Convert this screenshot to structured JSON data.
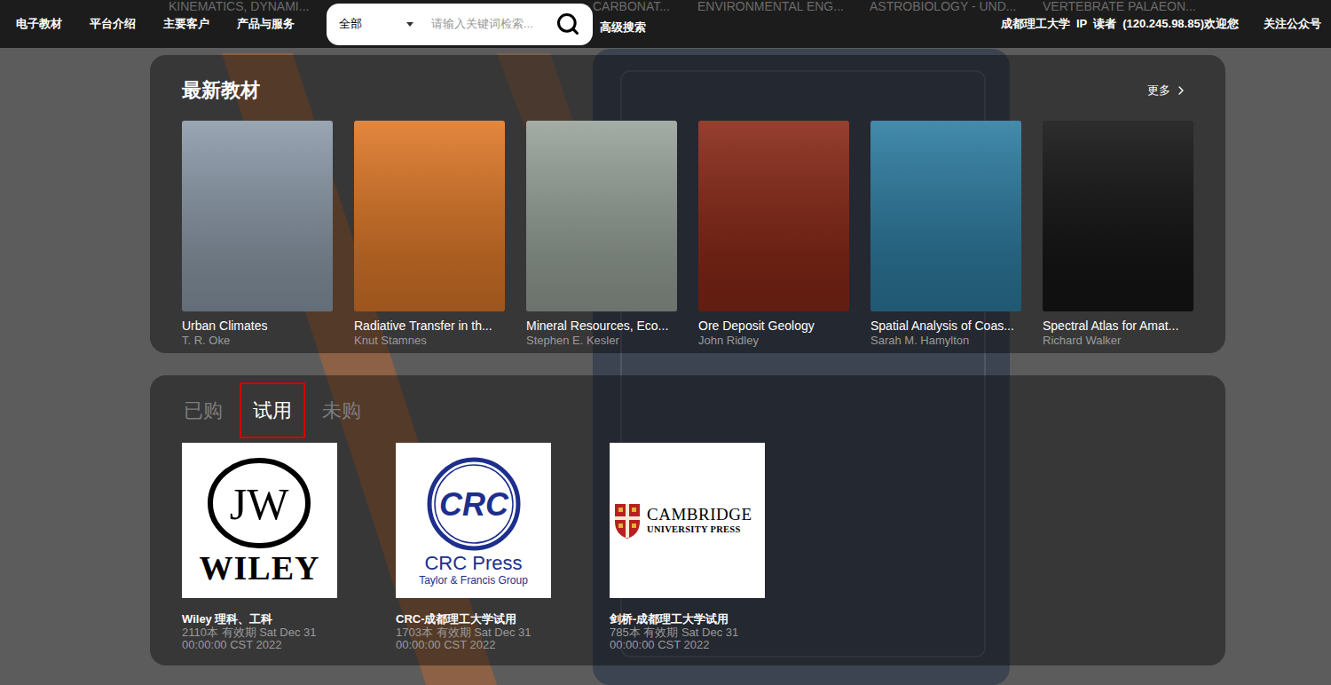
{
  "nav": {
    "links": [
      "电子教材",
      "平台介绍",
      "主要客户",
      "产品与服务"
    ],
    "search": {
      "scope": "全部",
      "placeholder": "请输入关键词检索..."
    },
    "advanced_search": "高级搜索",
    "user": [
      "成都理工大学",
      "IP",
      "读者",
      "(120.245.98.85)欢迎您"
    ],
    "follow": "关注公众号"
  },
  "background_titles": [
    "KINEMATICS, DYNAMI...",
    "CARBONAT...",
    "ENVIRONMENTAL ENG...",
    "ASTROBIOLOGY - UND...",
    "VERTEBRATE PALAEON..."
  ],
  "latest": {
    "title": "最新教材",
    "more": "更多",
    "books": [
      {
        "title": "Urban Climates",
        "author": "T. R. Oke",
        "color": "#8e9cab"
      },
      {
        "title": "Radiative Transfer in th...",
        "author": "Knut Stamnes",
        "color": "#e07a2a"
      },
      {
        "title": "Mineral Resources, Eco...",
        "author": "Stephen E. Kesler",
        "color": "#9aa49c"
      },
      {
        "title": "Ore Deposit Geology",
        "author": "John Ridley",
        "color": "#8a2a18"
      },
      {
        "title": "Spatial Analysis of Coas...",
        "author": "Sarah M. Hamylton",
        "color": "#2f7ea3"
      },
      {
        "title": "Spectral Atlas for Amat...",
        "author": "Richard Walker",
        "color": "#161616"
      }
    ]
  },
  "collections": {
    "tabs": [
      {
        "label": "已购",
        "selected": false
      },
      {
        "label": "试用",
        "selected": true
      },
      {
        "label": "未购",
        "selected": false
      }
    ],
    "items": [
      {
        "name": "Wiley 理科、工科",
        "details": "2110本 有效期 Sat Dec 31 00:00:00 CST 2022",
        "logo": {
          "kind": "wiley",
          "mark": "JW",
          "wordmark": "WILEY"
        }
      },
      {
        "name": "CRC-成都理工大学试用",
        "details": "1703本 有效期 Sat Dec 31 00:00:00 CST 2022",
        "logo": {
          "kind": "crc",
          "mark": "CRC",
          "wordmark": "CRC Press",
          "tagline": "Taylor & Francis Group"
        }
      },
      {
        "name": "剑桥-成都理工大学试用",
        "details": "785本 有效期 Sat Dec 31 00:00:00 CST 2022",
        "logo": {
          "kind": "cambridge",
          "wordmark": "CAMBRIDGE",
          "tagline": "UNIVERSITY PRESS"
        }
      }
    ]
  }
}
